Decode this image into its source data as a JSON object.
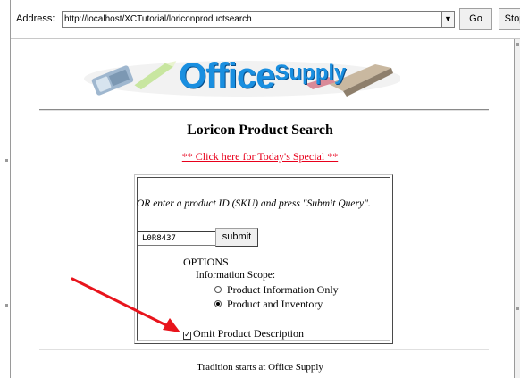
{
  "address_bar": {
    "label": "Address:",
    "url": "http://localhost/XCTutorial/loriconproductsearch",
    "go_label": "Go",
    "stop_label": "Stop"
  },
  "logo": {
    "word_office": "Office",
    "word_supply": "Supply"
  },
  "page": {
    "title": "Loricon Product Search",
    "special_link": "** Click here for Today's Special **"
  },
  "form": {
    "instruction": "OR enter a product ID (SKU) and press \"Submit Query\".",
    "sku_value": "L0R8437",
    "submit_label": "submit",
    "options_title": "OPTIONS",
    "scope_label": "Information Scope:",
    "scope_options": [
      {
        "label": "Product Information Only",
        "selected": false
      },
      {
        "label": "Product and Inventory",
        "selected": true
      }
    ],
    "omit_description_label": "Omit Product Description",
    "omit_description_checked": true
  },
  "footer": {
    "text": "Tradition starts at Office Supply"
  },
  "colors": {
    "link": "#e8001c",
    "logo_blue": "#1a8fe0",
    "arrow": "#e8141c"
  }
}
